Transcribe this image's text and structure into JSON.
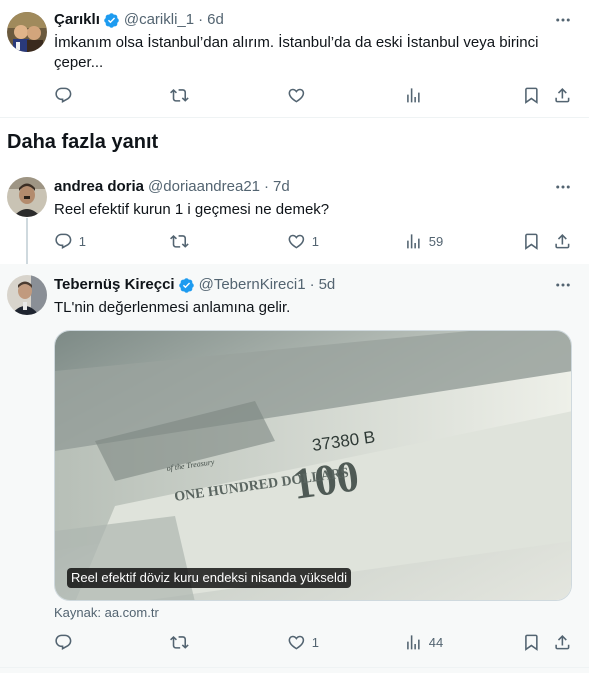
{
  "tweet1": {
    "name": "Çarıklı",
    "handle": "@carikli_1",
    "time": "6d",
    "text": "İmkanım olsa İstanbul’dan alırım. İstanbul’da da eski İstanbul veya birinci çeper..."
  },
  "section_title": "Daha fazla yanıt",
  "tweet2": {
    "name": "andrea doria",
    "handle": "@doriaandrea21",
    "time": "7d",
    "text": "Reel efektif kurun 1 i geçmesi ne demek?",
    "reply_count": "1",
    "like_count": "1",
    "view_count": "59"
  },
  "tweet3": {
    "name": "Tebernüş Kireçci",
    "handle": "@TebernKireci1",
    "time": "5d",
    "text": "TL'nin değerlenmesi anlamına gelir.",
    "card_caption": "Reel efektif döviz kuru endeksi nisanda yükseldi",
    "card_source": "Kaynak: aa.com.tr",
    "like_count": "1",
    "view_count": "44",
    "banknote_serial": "37380 B",
    "banknote_value": "100",
    "banknote_text1": "of the Treasury",
    "banknote_text2": "ONE HUNDRED DOLLARS"
  },
  "dot": "·",
  "icons": {
    "reply": "reply-icon",
    "retweet": "retweet-icon",
    "like": "like-icon",
    "views": "views-icon",
    "bookmark": "bookmark-icon",
    "share": "share-icon",
    "more": "more-icon",
    "verified": "verified-badge-icon"
  },
  "colors": {
    "verified": "#1d9bf0",
    "secondary_text": "#536471"
  }
}
